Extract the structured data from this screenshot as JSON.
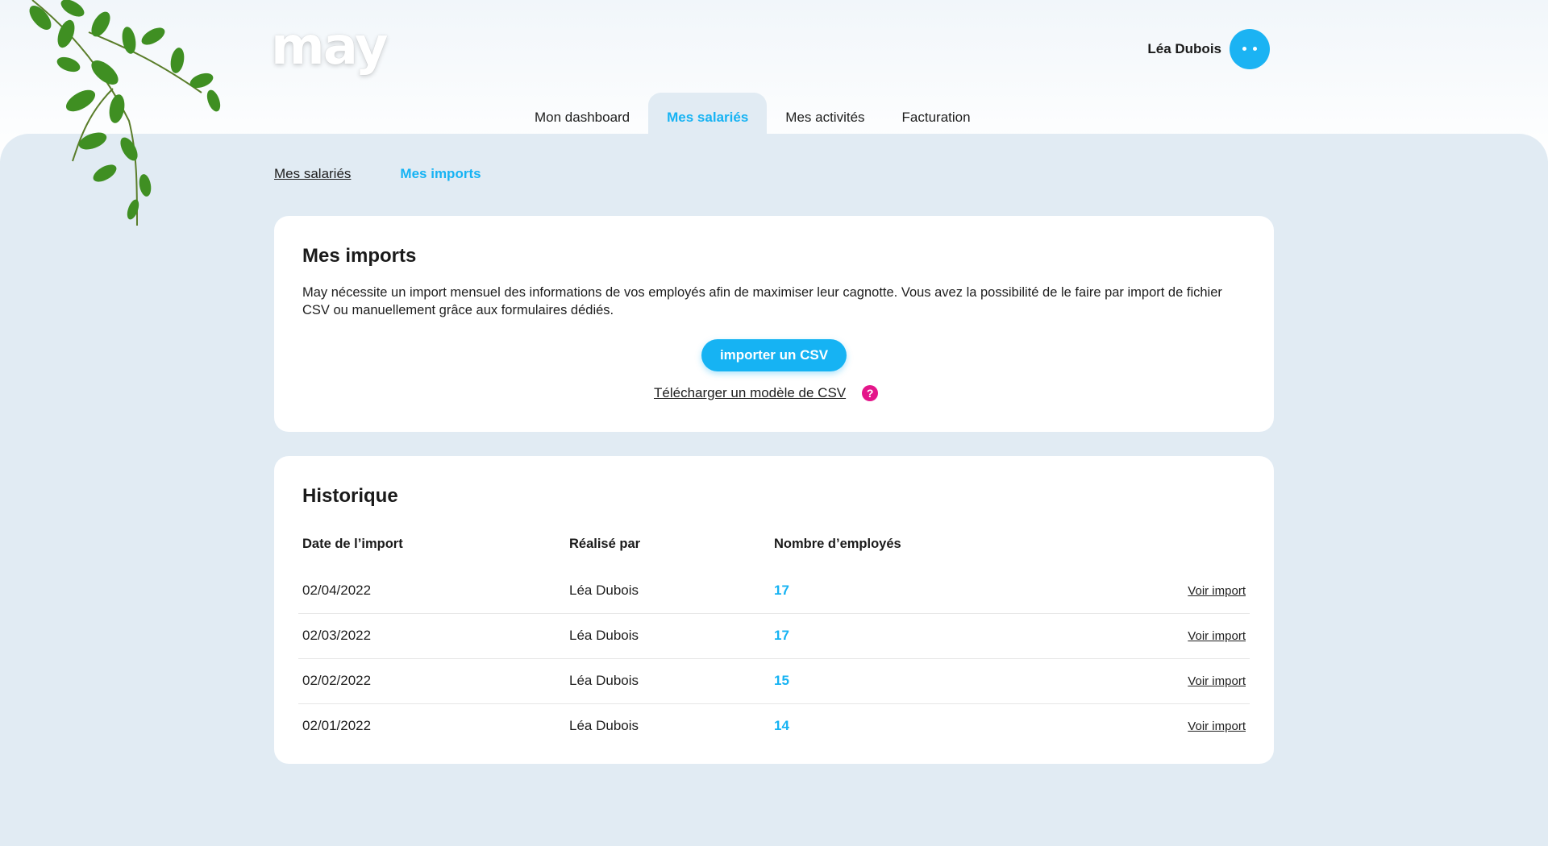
{
  "brand": {
    "logo": "may",
    "accent": "#16b3f3",
    "help_color": "#e4168a"
  },
  "user": {
    "name": "Léa Dubois"
  },
  "main_nav": [
    {
      "label": "Mon dashboard",
      "active": false
    },
    {
      "label": "Mes salariés",
      "active": true
    },
    {
      "label": "Mes activités",
      "active": false
    },
    {
      "label": "Facturation",
      "active": false
    }
  ],
  "sub_nav": [
    {
      "label": "Mes salariés",
      "active": false
    },
    {
      "label": "Mes imports",
      "active": true
    }
  ],
  "imports": {
    "title": "Mes imports",
    "description": "May nécessite un import mensuel des informations de vos employés afin de maximiser leur cagnotte. Vous avez la possibilité de le faire par import de fichier CSV ou manuellement grâce aux formulaires dédiés.",
    "button": "importer un CSV",
    "download_link": "Télécharger un modèle de CSV",
    "help_icon": "?"
  },
  "history": {
    "title": "Historique",
    "columns": [
      "Date de l’import",
      "Réalisé par",
      "Nombre d’employés"
    ],
    "rows": [
      {
        "date": "02/04/2022",
        "by": "Léa Dubois",
        "count": "17",
        "action": "Voir import"
      },
      {
        "date": "02/03/2022",
        "by": "Léa Dubois",
        "count": "17",
        "action": "Voir import"
      },
      {
        "date": "02/02/2022",
        "by": "Léa Dubois",
        "count": "15",
        "action": "Voir import"
      },
      {
        "date": "02/01/2022",
        "by": "Léa Dubois",
        "count": "14",
        "action": "Voir import"
      }
    ]
  }
}
